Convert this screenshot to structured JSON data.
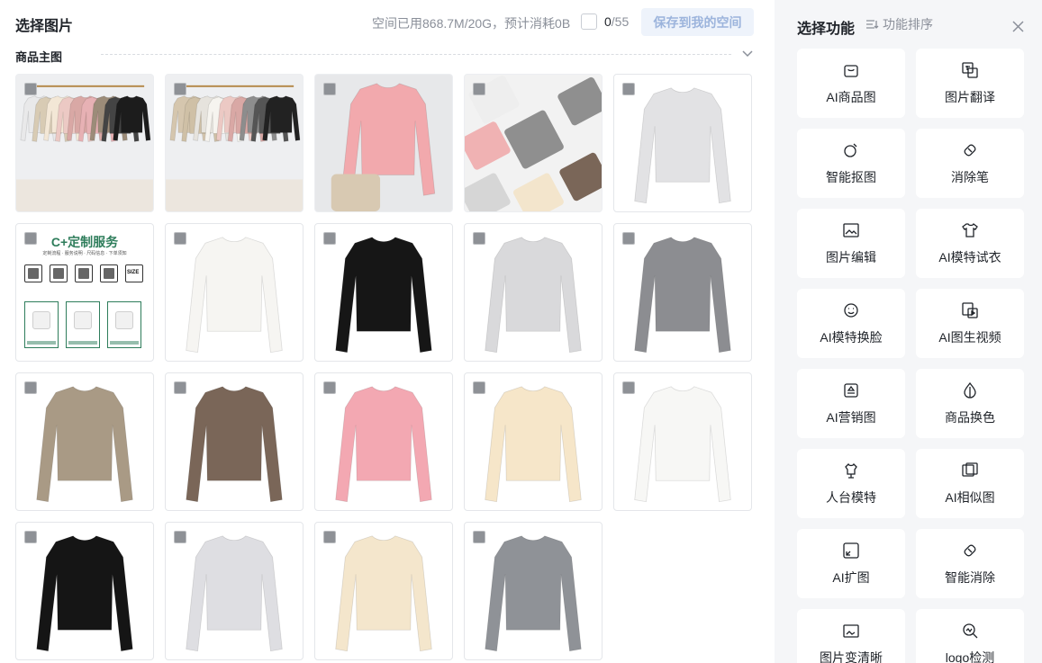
{
  "header": {
    "title": "选择图片",
    "usage_text": "空间已用868.7M/20G，预计消耗0B",
    "selected_count": "0",
    "total_count": "/55",
    "save_label": "保存到我的空间"
  },
  "section": {
    "title": "商品主图"
  },
  "info_card": {
    "title": "C+定制服务",
    "subtitle": "定制流程 · 服务说明 · 尺码信息 · 下单须知",
    "size_label": "SIZE"
  },
  "images": [
    {
      "kind": "photo-rack",
      "colors": [
        "#e9e9ea",
        "#d8cbb4",
        "#f3e7d6",
        "#ecc9c4",
        "#d9a8a5",
        "#e7b1b4",
        "#9c8c79",
        "#444444",
        "#1c1c1c"
      ]
    },
    {
      "kind": "photo-rack",
      "colors": [
        "#d5c6ae",
        "#cfc0a6",
        "#e6e3dd",
        "#f6f4ef",
        "#ecc9c4",
        "#d9a8a5",
        "#8d8d8d",
        "#555555",
        "#222222"
      ]
    },
    {
      "kind": "photo-single",
      "colors": [
        "#f2a9ad"
      ]
    },
    {
      "kind": "photo-flat",
      "colors": [
        "#eeeeee",
        "#8f8f8f",
        "#f0b2b3",
        "#7a6658",
        "#f3e5cc",
        "#d6d6d6"
      ]
    },
    {
      "kind": "shirt",
      "colors": [
        "#e2e2e4"
      ]
    },
    {
      "kind": "info"
    },
    {
      "kind": "shirt",
      "colors": [
        "#f6f5f2"
      ]
    },
    {
      "kind": "shirt",
      "colors": [
        "#161616"
      ]
    },
    {
      "kind": "shirt",
      "colors": [
        "#d9d9db"
      ]
    },
    {
      "kind": "shirt",
      "colors": [
        "#8c8d91"
      ]
    },
    {
      "kind": "shirt",
      "colors": [
        "#a99a85"
      ]
    },
    {
      "kind": "shirt",
      "colors": [
        "#7a6658"
      ]
    },
    {
      "kind": "shirt",
      "colors": [
        "#f3a8b2"
      ]
    },
    {
      "kind": "shirt",
      "colors": [
        "#f6e6c9"
      ]
    },
    {
      "kind": "shirt",
      "colors": [
        "#f7f7f5"
      ]
    },
    {
      "kind": "shirt",
      "colors": [
        "#151515"
      ]
    },
    {
      "kind": "shirt",
      "colors": [
        "#dedee2"
      ]
    },
    {
      "kind": "shirt",
      "colors": [
        "#f4e6cc"
      ]
    },
    {
      "kind": "shirt",
      "colors": [
        "#8f9297"
      ]
    }
  ],
  "side": {
    "title": "选择功能",
    "sort_label": "功能排序",
    "functions": [
      {
        "label": "AI商品图",
        "icon": "bag-icon"
      },
      {
        "label": "图片翻译",
        "icon": "translate-icon"
      },
      {
        "label": "智能抠图",
        "icon": "cutout-icon"
      },
      {
        "label": "消除笔",
        "icon": "eraser-icon"
      },
      {
        "label": "图片编辑",
        "icon": "image-edit-icon"
      },
      {
        "label": "AI模特试衣",
        "icon": "tshirt-icon"
      },
      {
        "label": "AI模特换脸",
        "icon": "face-icon"
      },
      {
        "label": "AI图生视频",
        "icon": "video-icon"
      },
      {
        "label": "AI营销图",
        "icon": "marketing-icon"
      },
      {
        "label": "商品换色",
        "icon": "color-drop-icon"
      },
      {
        "label": "人台模特",
        "icon": "mannequin-icon"
      },
      {
        "label": "AI相似图",
        "icon": "similar-image-icon"
      },
      {
        "label": "AI扩图",
        "icon": "expand-icon"
      },
      {
        "label": "智能消除",
        "icon": "smart-erase-icon"
      },
      {
        "label": "图片变清晰",
        "icon": "hd-icon"
      },
      {
        "label": "logo检测",
        "icon": "logo-detect-icon"
      }
    ]
  },
  "colors": {
    "accent_disabled_text": "#9cb4dc",
    "accent_disabled_bg": "#eef3fb",
    "info_green": "#2e7d5b",
    "panel_bg": "#f5f6f8"
  }
}
